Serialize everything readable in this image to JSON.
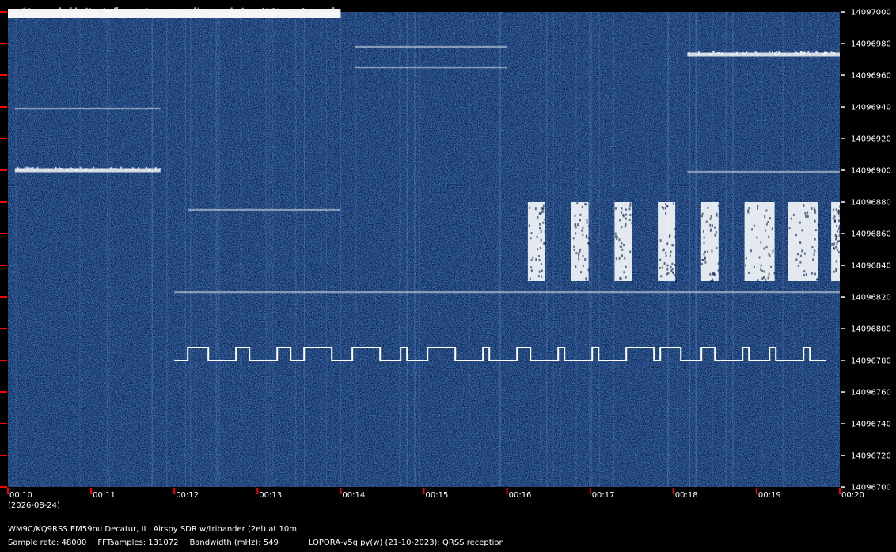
{
  "chart_data": {
    "type": "heatmap",
    "y_axis": {
      "ticks": [
        14097000,
        14096980,
        14096960,
        14096940,
        14096920,
        14096900,
        14096880,
        14096860,
        14096840,
        14096820,
        14096800,
        14096780,
        14096760,
        14096740,
        14096720,
        14096700
      ],
      "ylim": [
        14096700,
        14097000
      ]
    },
    "x_axis": {
      "ticks": [
        "00:10",
        "00:11",
        "00:12",
        "00:13",
        "00:14",
        "00:15",
        "00:16",
        "00:17",
        "00:18",
        "00:19",
        "00:20"
      ],
      "date_label": "(2026-08-24)"
    },
    "signals": [
      {
        "kind": "band",
        "t_start": "00:10",
        "t_end": "00:14",
        "freq": 14096999,
        "strength": "strong"
      },
      {
        "kind": "band",
        "t_start": "00:10:05",
        "t_end": "00:11:50",
        "freq": 14096900,
        "strength": "medium"
      },
      {
        "kind": "band",
        "t_start": "00:10:05",
        "t_end": "00:11:50",
        "freq": 14096939,
        "strength": "weak"
      },
      {
        "kind": "band",
        "t_start": "00:12:10",
        "t_end": "00:14",
        "freq": 14096875,
        "strength": "weak"
      },
      {
        "kind": "band",
        "t_start": "00:18:10",
        "t_end": "00:20",
        "freq": 14096973,
        "strength": "medium"
      },
      {
        "kind": "band",
        "t_start": "00:18:10",
        "t_end": "00:20",
        "freq": 14096899,
        "strength": "weak"
      },
      {
        "kind": "band",
        "t_start": "00:14:10",
        "t_end": "00:16",
        "freq": 14096978,
        "strength": "weak"
      },
      {
        "kind": "band",
        "t_start": "00:14:10",
        "t_end": "00:16",
        "freq": 14096965,
        "strength": "weak"
      },
      {
        "kind": "band",
        "t_start": "00:12",
        "t_end": "00:20",
        "freq": 14096823,
        "strength": "weak"
      },
      {
        "kind": "fsk",
        "t_start": "00:12",
        "t_end": "00:19:50",
        "freq_low": 14096780,
        "freq_high": 14096788
      },
      {
        "kind": "bursts",
        "t_start": "00:16:15",
        "t_end": "00:20",
        "freq_low": 14096830,
        "freq_high": 14096880
      }
    ]
  },
  "footer": {
    "station": "WM9C/KQ9RSS EM59nu Decatur, IL  Airspy SDR w/tribander (2el) at 10m",
    "sample_rate": "Sample rate: 48000",
    "fft_samples": "FFTsamples: 131072",
    "bandwidth": "Bandwidth (mHz): 549",
    "software": "LOPORA-v5g.py(w) (21-10-2023): QRSS reception"
  },
  "colors": {
    "background": "#001a45",
    "signal": "#ffffff",
    "tick": "#ff0000",
    "text": "#ffffff"
  }
}
